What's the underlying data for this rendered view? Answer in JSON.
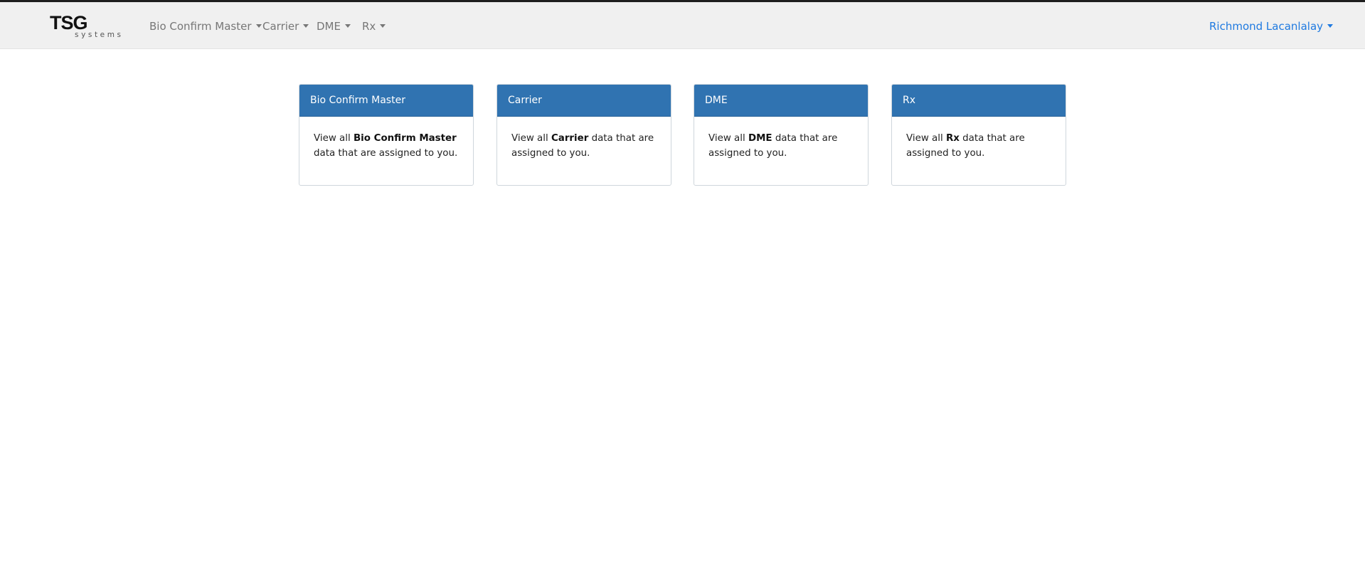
{
  "brand": {
    "main": "TSG",
    "sub": "systems"
  },
  "nav": {
    "items": [
      {
        "label": "Bio Confirm Master"
      },
      {
        "label": "Carrier"
      },
      {
        "label": "DME"
      },
      {
        "label": "Rx"
      }
    ],
    "user": {
      "label": "Richmond Lacanlalay"
    }
  },
  "cards": [
    {
      "title": "Bio Confirm Master",
      "prefix": "View all",
      "name": "Bio Confirm Master",
      "suffix": "data that are assigned to you."
    },
    {
      "title": "Carrier",
      "prefix": "View all",
      "name": "Carrier",
      "suffix": "data that are assigned to you."
    },
    {
      "title": "DME",
      "prefix": "View all",
      "name": "DME",
      "suffix": "data that are assigned to you."
    },
    {
      "title": "Rx",
      "prefix": "View all",
      "name": "Rx",
      "suffix": "data that are assigned to you."
    }
  ],
  "colors": {
    "navbar_bg": "#f0f0f0",
    "card_header": "#3073b1",
    "user_link": "#1f7ae0",
    "nav_text": "#777777"
  }
}
